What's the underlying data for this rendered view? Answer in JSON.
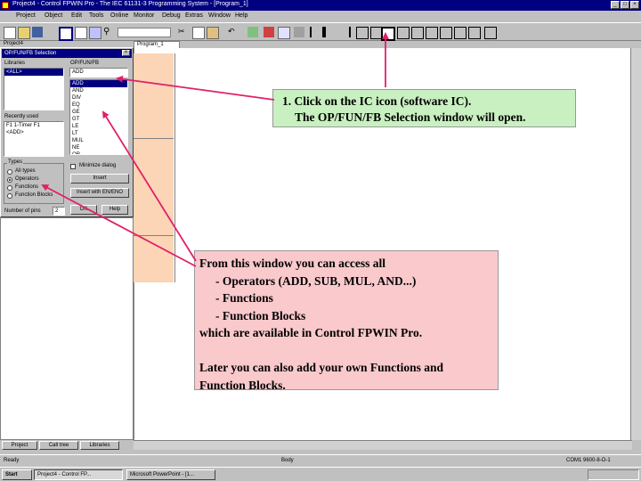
{
  "window": {
    "title": "Project4 - Control FPWIN Pro - The IEC 61131-3 Programming System - [Program_1]"
  },
  "menu": [
    "Project",
    "Object",
    "Edit",
    "Tools",
    "Online",
    "Monitor",
    "Debug",
    "Extras",
    "Window",
    "Help"
  ],
  "object_bar_label": "Project4",
  "document_tab": "Program_1",
  "dialog": {
    "title": "OP/FUN/FB Selection",
    "libraries_label": "Libraries",
    "library_value": "<ALL>",
    "opfun_label": "OP/FUN/FB",
    "opfun_field": "ADD",
    "opfun_items": [
      "ADD",
      "AND",
      "DIV",
      "EQ",
      "GE",
      "GT",
      "LE",
      "LT",
      "MUL",
      "NE",
      "OR"
    ],
    "opfun_selected": 0,
    "recently_used_label": "Recently used",
    "recent_items": [
      "F1 1-Timer F1",
      "<ADD>"
    ],
    "types_label": "Types",
    "types": [
      "All types",
      "Operators",
      "Functions",
      "Function Blocks"
    ],
    "types_selected": 1,
    "minimize_label": "Minimize dialog",
    "insert_button": "Insert",
    "insert_en_button": "Insert with EN/ENO",
    "number_of_pins_label": "Number of pins",
    "number_of_pins_value": "2",
    "ok_button": "OK",
    "help_button": "Help"
  },
  "left_tabs": [
    "Project",
    "Call tree",
    "Libraries"
  ],
  "status": {
    "ready": "Ready",
    "mode": "Body",
    "right": "COM1 9600-8-O-1"
  },
  "taskbar": {
    "start": "Start",
    "items": [
      "Project4 - Control FP...",
      "Microsoft PowerPoint - [1..."
    ]
  },
  "callout1": {
    "line1": "1. Click on the IC icon (software IC).",
    "line2": "The OP/FUN/FB Selection window will open."
  },
  "callout2": {
    "lines": [
      "From this window you can access all",
      "- Operators (ADD, SUB, MUL, AND...)",
      "- Functions",
      "- Function Blocks",
      "which are available in Control FPWIN Pro.",
      "",
      "Later you can also add your own Functions and",
      "Function Blocks."
    ]
  },
  "colors": {
    "titlebar": "#000080",
    "green_callout": "#c9f0c0",
    "pink_callout": "#f9c9cc",
    "arrow": "#e0206a",
    "network_fill": "#fbd5b5"
  }
}
